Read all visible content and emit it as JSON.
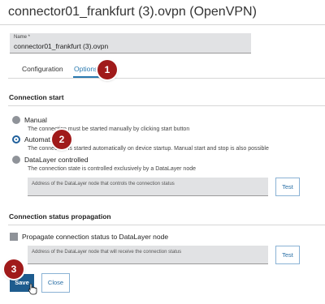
{
  "window": {
    "title": "connector01_frankfurt (3).ovpn (OpenVPN)"
  },
  "name_field": {
    "label": "Name *",
    "value": "connector01_frankfurt (3).ovpn"
  },
  "tabs": [
    {
      "label": "Configuration",
      "active": false
    },
    {
      "label": "Options",
      "active": true
    }
  ],
  "connection_start": {
    "heading": "Connection start",
    "options": [
      {
        "label": "Manual",
        "description": "The connection must be started manually by clicking start button",
        "selected": false
      },
      {
        "label": "Automatic",
        "description": "The connection is started automatically on device startup. Manual start and stop is also possible",
        "selected": true
      },
      {
        "label": "DataLayer controlled",
        "description": "The connection state is controlled exclusively by a DataLayer node",
        "selected": false
      }
    ],
    "node_field_placeholder": "Address of the DataLayer node that controls the connection status",
    "test_label": "Test"
  },
  "propagation": {
    "heading": "Connection status propagation",
    "checkbox_label": "Propagate connection status to DataLayer node",
    "checked": false,
    "node_field_placeholder": "Address of the DataLayer node that will receive the connection status",
    "test_label": "Test"
  },
  "footer": {
    "save_label": "Save",
    "close_label": "Close"
  },
  "badges": [
    "1",
    "2",
    "3"
  ],
  "colors": {
    "accent": "#2a7ab0",
    "save_button": "#1e5c8e",
    "badge": "#a01a1a",
    "field_bg": "#e1e2e4"
  }
}
